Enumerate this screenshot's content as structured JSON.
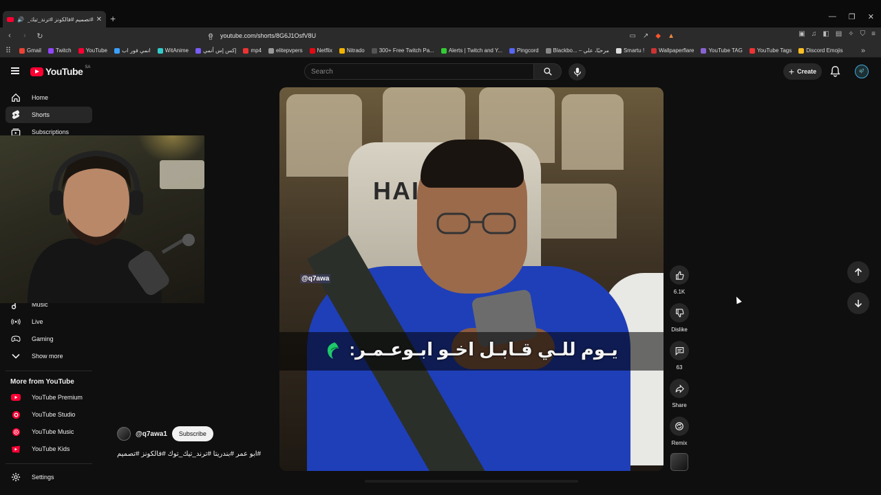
{
  "browser": {
    "tab_title": "#تصميم #فالكونز #ترند_تيك_تو",
    "url": "youtube.com/shorts/8G6J1OsfV8U",
    "bookmarks": [
      {
        "label": "Gmail",
        "color": "#ea4335"
      },
      {
        "label": "Twitch",
        "color": "#9146ff"
      },
      {
        "label": "YouTube",
        "color": "#ff0033"
      },
      {
        "label": "انمي فور اب",
        "color": "#3aa1ff"
      },
      {
        "label": "WitAnime",
        "color": "#3cc"
      },
      {
        "label": "إكس إس أنمي",
        "color": "#7a5cff"
      },
      {
        "label": "mp4",
        "color": "#e33"
      },
      {
        "label": "elitepvpers",
        "color": "#999"
      },
      {
        "label": "Netflix",
        "color": "#e50914"
      },
      {
        "label": "Nitrado",
        "color": "#f0b400"
      },
      {
        "label": "300+ Free Twitch Pa...",
        "color": "#555"
      },
      {
        "label": "Alerts | Twitch and Y...",
        "color": "#3c3"
      },
      {
        "label": "Pingcord",
        "color": "#5865f2"
      },
      {
        "label": "Blackbo... – مرحبًا، علي",
        "color": "#888"
      },
      {
        "label": "Smartu !",
        "color": "#ddd"
      },
      {
        "label": "Wallpaperflare",
        "color": "#c33"
      },
      {
        "label": "YouTube TAG",
        "color": "#8a63d2"
      },
      {
        "label": "YouTube Tags",
        "color": "#e33"
      },
      {
        "label": "Discord Emojis",
        "color": "#fbbf24"
      }
    ]
  },
  "header": {
    "logo_text": "YouTube",
    "country_code": "SA",
    "search_placeholder": "Search",
    "create_label": "Create",
    "avatar_text": "q7"
  },
  "sidebar": {
    "items_top": [
      {
        "label": "Home",
        "icon": "home-icon"
      },
      {
        "label": "Shorts",
        "icon": "shorts-icon",
        "active": true
      },
      {
        "label": "Subscriptions",
        "icon": "subscriptions-icon"
      }
    ],
    "items_mid": [
      {
        "label": "Music",
        "icon": "music-icon"
      },
      {
        "label": "Live",
        "icon": "live-icon"
      },
      {
        "label": "Gaming",
        "icon": "gaming-icon"
      },
      {
        "label": "Show more",
        "icon": "chevron-down-icon"
      }
    ],
    "more_title": "More from YouTube",
    "more_items": [
      {
        "label": "YouTube Premium"
      },
      {
        "label": "YouTube Studio"
      },
      {
        "label": "YouTube Music"
      },
      {
        "label": "YouTube Kids"
      }
    ],
    "settings_label": "Settings"
  },
  "video": {
    "chair_text": "HAIB",
    "caption": "يـوم للـي قـابـل اخـو ابـوعـمـر:",
    "watermark": "@q7awa"
  },
  "actions": {
    "like_count": "6.1K",
    "dislike_label": "Dislike",
    "comment_count": "63",
    "share_label": "Share",
    "remix_label": "Remix"
  },
  "channel": {
    "handle": "@q7awa1",
    "subscribe_label": "Subscribe",
    "hashtags": "#ابو عمر #بندريتا #ترند_تيك_توك #فالكونز #تصميم"
  },
  "colors": {
    "accent": "#ff0033",
    "background": "#0f0f0f",
    "surface": "#272727"
  }
}
